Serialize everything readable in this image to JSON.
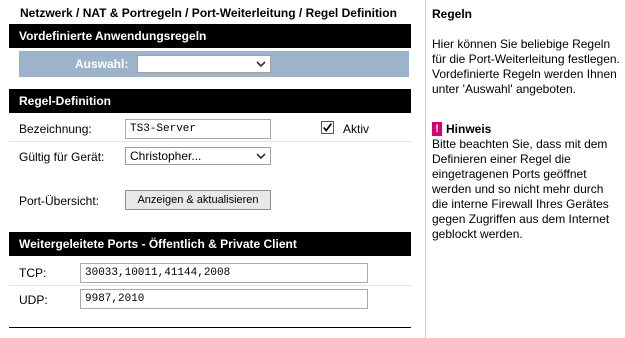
{
  "breadcrumb": "Netzwerk / NAT & Portregeln / Port-Weiterleitung / Regel Definition",
  "preset_section": {
    "title": "Vordefinierte Anwendungsregeln",
    "select_label": "Auswahl:",
    "select_value": ""
  },
  "rule_section": {
    "title": "Regel-Definition",
    "name_label": "Bezeichnung:",
    "name_value": "TS3-Server",
    "active_label": "Aktiv",
    "active_checked": true,
    "device_label": "Gültig für Gerät:",
    "device_value": "Christopher...",
    "port_overview_label": "Port-Übersicht:",
    "port_overview_button": "Anzeigen & aktualisieren"
  },
  "ports_section": {
    "title": "Weitergeleitete Ports - Öffentlich & Private Client",
    "tcp_label": "TCP:",
    "tcp_value": "30033,10011,41144,2008",
    "udp_label": "UDP:",
    "udp_value": "9987,2010"
  },
  "sidebar": {
    "title": "Regeln",
    "text": "Hier können Sie beliebige Regeln für die Port-Weiterleitung festlegen. Vordefinierte Regeln werden Ihnen unter 'Auswahl' angeboten.",
    "hint_icon": "!",
    "hint_title": "Hinweis",
    "hint_text": "Bitte beachten Sie, dass mit dem Definieren einer Regel die eingetragenen Ports geöffnet werden und so nicht mehr durch die interne Firewall Ihres Gerätes gegen Zugriffen aus dem Internet geblockt werden."
  },
  "colors": {
    "section_header_bg": "#000000",
    "preset_band_bg": "#9db3cc",
    "hint_icon_bg": "#d8006f"
  }
}
